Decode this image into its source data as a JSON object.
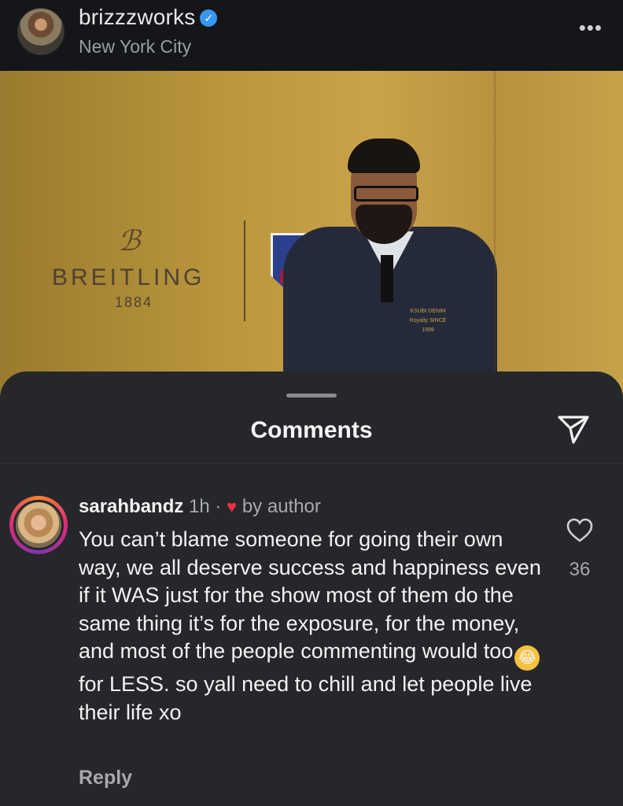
{
  "header": {
    "username": "brizzzworks",
    "verified_mark": "✓",
    "location": "New York City",
    "more_label": "•••"
  },
  "photo": {
    "brand_logo": "ℬ",
    "brand_name": "BREITLING",
    "brand_year": "1884",
    "patch_text": "KSUBI DENIM Royalty SINCE 1999"
  },
  "comments_sheet": {
    "title": "Comments",
    "send_icon": "send-icon",
    "comment": {
      "username": "sarahbandz",
      "time": "1h",
      "separator": "·",
      "liked_by_author": "by author",
      "text_before_emoji": "You can’t blame someone for going their own way, we all deserve success and happiness even if it WAS just for the show most of them do the same thing it’s for the exposure, for the money, and most of the people commenting would too",
      "emoji": "😂",
      "text_after_emoji": "for LESS. so yall need to chill and let people live their life xo",
      "like_count": "36",
      "reply_label": "Reply"
    }
  },
  "colors": {
    "background": "#1c1d20",
    "sheet": "#26272b",
    "verified": "#3897f0",
    "heart": "#ed3045"
  }
}
